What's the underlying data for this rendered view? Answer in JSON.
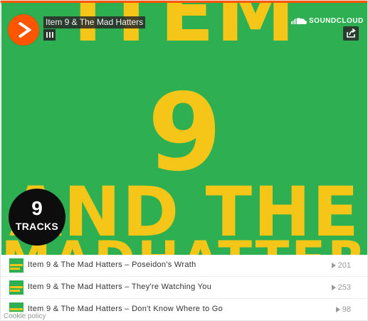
{
  "header": {
    "title": "Item 9 & The Mad Hatters",
    "brand_label": "SOUNDCLOUD",
    "brand_color": "#ff5500"
  },
  "artwork": {
    "line1": "ITEM",
    "line2": "9",
    "line3": "AND THE",
    "line4": "MADHATTERS",
    "background_color": "#2eb052",
    "text_color": "#f5c518"
  },
  "playlist_count": {
    "number": "9",
    "label": "TRACKS"
  },
  "icons": {
    "play": "play-icon",
    "menu": "menu-icon",
    "soundcloud": "soundcloud-logo-icon",
    "share": "share-icon",
    "plays": "play-count-icon"
  },
  "tracks": [
    {
      "title": "Item 9 & The Mad Hatters – Poseidon's Wrath",
      "plays": "201"
    },
    {
      "title": "Item 9 & The Mad Hatters – They're Watching You",
      "plays": "253"
    },
    {
      "title": "Item 9 & The Mad Hatters – Don't Know Where to Go",
      "plays": "98"
    }
  ],
  "footer": {
    "cookie_policy": "Cookie policy"
  }
}
